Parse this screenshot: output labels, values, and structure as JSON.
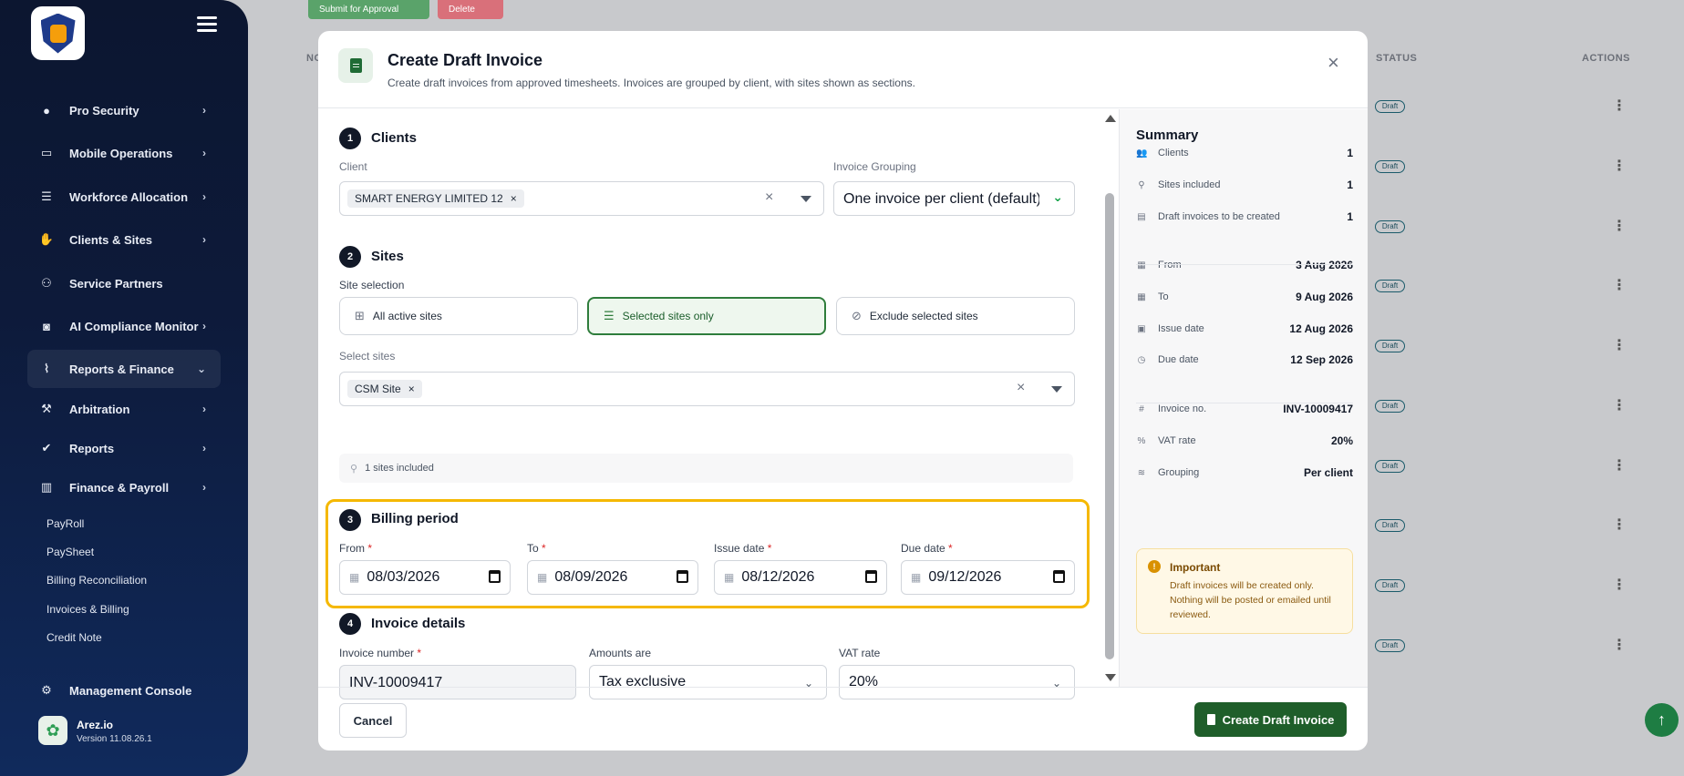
{
  "sidebar": {
    "items": [
      {
        "label": "Pro Security",
        "icon": "user-icon"
      },
      {
        "label": "Mobile Operations",
        "icon": "car-icon"
      },
      {
        "label": "Workforce Allocation",
        "icon": "list-icon"
      },
      {
        "label": "Clients & Sites",
        "icon": "handshake-icon"
      },
      {
        "label": "Service Partners",
        "icon": "partners-icon"
      },
      {
        "label": "AI Compliance Monitor",
        "icon": "robot-icon"
      },
      {
        "label": "Reports & Finance",
        "icon": "chart-line-icon"
      },
      {
        "label": "Arbitration",
        "icon": "gavel-icon"
      },
      {
        "label": "Reports",
        "icon": "user-check-icon"
      },
      {
        "label": "Finance & Payroll",
        "icon": "bar-chart-icon"
      }
    ],
    "sub_items": [
      "PayRoll",
      "PaySheet",
      "Billing Reconciliation",
      "Invoices & Billing",
      "Credit Note"
    ],
    "management": "Management Console",
    "brand_name": "Arez.io",
    "brand_version": "Version 11.08.26.1"
  },
  "background": {
    "submit_btn": "Submit for Approval",
    "delete_btn": "Delete",
    "col_no": "NO",
    "col_status": "STATUS",
    "col_actions": "ACTIONS",
    "draft_badge": "Draft"
  },
  "modal": {
    "title": "Create Draft Invoice",
    "subtitle": "Create draft invoices from approved timesheets. Invoices are grouped by client, with sites shown as sections.",
    "step1": {
      "num": "1",
      "title": "Clients",
      "client_label": "Client",
      "client_chip": "SMART ENERGY LIMITED 12",
      "grouping_label": "Invoice Grouping",
      "grouping_value": "One invoice per client (default)"
    },
    "step2": {
      "num": "2",
      "title": "Sites",
      "selection_label": "Site selection",
      "opt_all": "All active sites",
      "opt_selected": "Selected sites only",
      "opt_exclude": "Exclude selected sites",
      "select_label": "Select sites",
      "site_chip": "CSM Site",
      "included": "1 sites included"
    },
    "step3": {
      "num": "3",
      "title": "Billing period",
      "from_label": "From",
      "from_value": "08/03/2026",
      "to_label": "To",
      "to_value": "08/09/2026",
      "issue_label": "Issue date",
      "issue_value": "08/12/2026",
      "due_label": "Due date",
      "due_value": "09/12/2026"
    },
    "step4": {
      "num": "4",
      "title": "Invoice details",
      "inv_label": "Invoice number",
      "inv_value": "INV-10009417",
      "amounts_label": "Amounts are",
      "amounts_value": "Tax exclusive",
      "vat_label": "VAT rate",
      "vat_value": "20%"
    },
    "cancel": "Cancel",
    "create": "Create Draft Invoice"
  },
  "summary": {
    "title": "Summary",
    "rows": [
      {
        "label": "Clients",
        "value": "1",
        "icon": "users-icon"
      },
      {
        "label": "Sites included",
        "value": "1",
        "icon": "pin-icon"
      },
      {
        "label": "Draft invoices to be created",
        "value": "1",
        "icon": "doc-icon"
      },
      {
        "label": "From",
        "value": "3 Aug 2026",
        "icon": "calendar-icon"
      },
      {
        "label": "To",
        "value": "9 Aug 2026",
        "icon": "calendar-icon"
      },
      {
        "label": "Issue date",
        "value": "12 Aug 2026",
        "icon": "calendar-check-icon"
      },
      {
        "label": "Due date",
        "value": "12 Sep 2026",
        "icon": "clock-icon"
      },
      {
        "label": "Invoice no.",
        "value": "INV-10009417",
        "icon": "hash-icon"
      },
      {
        "label": "VAT rate",
        "value": "20%",
        "icon": "percent-icon"
      },
      {
        "label": "Grouping",
        "value": "Per client",
        "icon": "layers-icon"
      }
    ],
    "important_title": "Important",
    "important_text": "Draft invoices will be created only. Nothing will be posted or emailed until reviewed."
  },
  "colors": {
    "accent": "#1f5e2a",
    "highlight": "#f5b800",
    "sidebar": "#0c1630"
  }
}
